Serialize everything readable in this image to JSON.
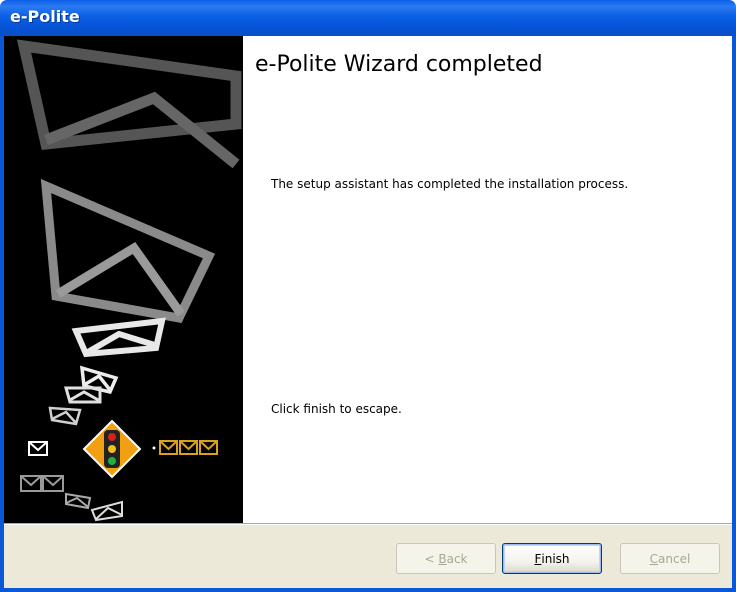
{
  "window": {
    "title": "e-Polite"
  },
  "content": {
    "heading": "e-Polite Wizard completed",
    "message_top": "The setup assistant has completed the installation process.",
    "message_bottom": "Click finish to escape."
  },
  "buttons": {
    "back": {
      "accel": "<",
      "pre": " ",
      "acc": "B",
      "post": "ack",
      "enabled": false
    },
    "finish": {
      "acc": "F",
      "post": "inish",
      "enabled": true,
      "default": true
    },
    "cancel": {
      "acc": "C",
      "post": "ancel",
      "enabled": false
    }
  },
  "side_graphic": {
    "icons": [
      "envelope-icon",
      "traffic-light-icon"
    ],
    "colors": {
      "background": "#000000",
      "envelope_gray": "#8a8a8a",
      "envelope_white": "#f0f0f0",
      "accent_orange": "#f2a012",
      "accent_gold": "#d9a21b"
    }
  }
}
